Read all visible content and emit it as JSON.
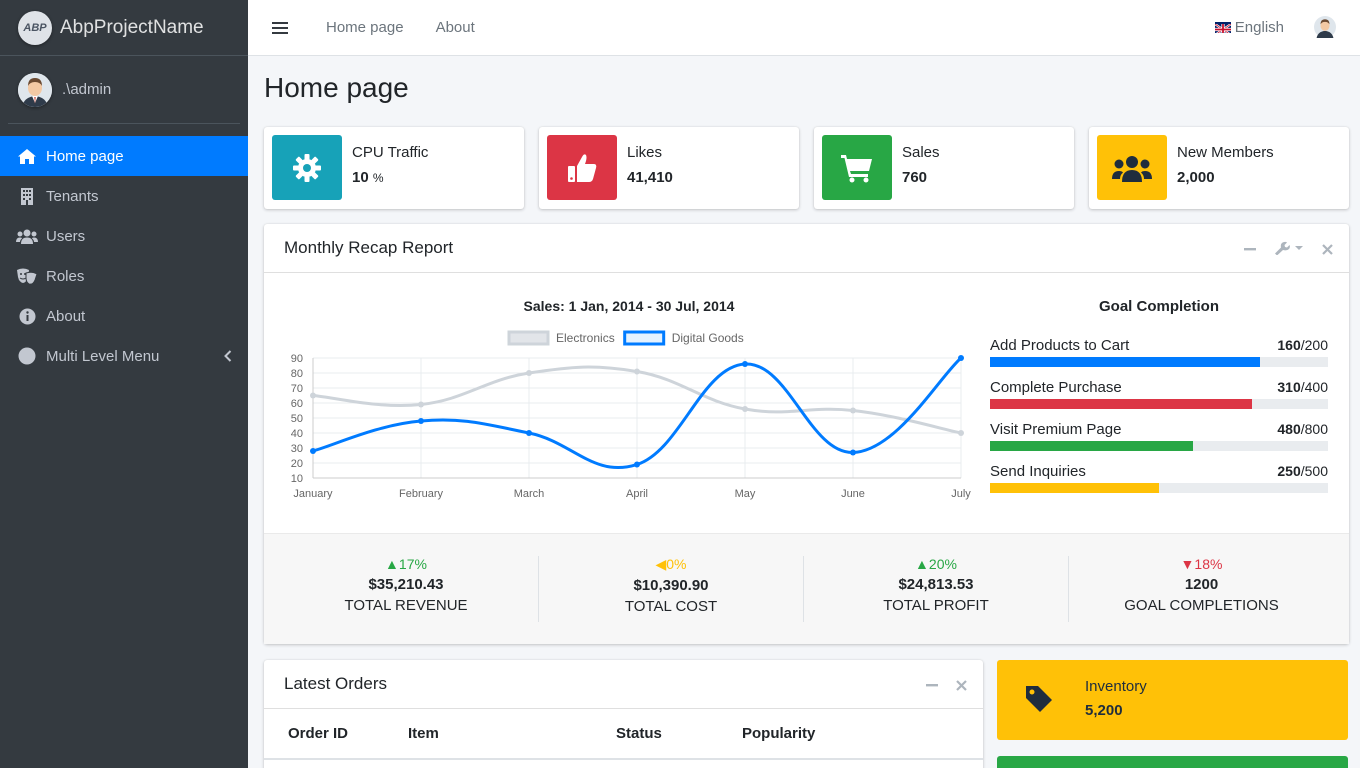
{
  "app": {
    "name": "AbpProjectName",
    "logo_text": "ABP"
  },
  "user": {
    "name": ".\\admin"
  },
  "sidebar": {
    "items": [
      {
        "label": "Home page",
        "icon": "home-icon",
        "active": true
      },
      {
        "label": "Tenants",
        "icon": "building-icon"
      },
      {
        "label": "Users",
        "icon": "users-icon"
      },
      {
        "label": "Roles",
        "icon": "theater-masks-icon"
      },
      {
        "label": "About",
        "icon": "info-circle-icon"
      },
      {
        "label": "Multi Level Menu",
        "icon": "circle-icon"
      }
    ]
  },
  "topbar": {
    "links": [
      "Home page",
      "About"
    ],
    "language": "English"
  },
  "page": {
    "title": "Home page"
  },
  "info_boxes": [
    {
      "label": "CPU Traffic",
      "value": "10",
      "unit": "%",
      "color": "#17a2b8",
      "icon": "gear-icon"
    },
    {
      "label": "Likes",
      "value": "41,410",
      "color": "#dc3545",
      "icon": "thumbs-up-icon"
    },
    {
      "label": "Sales",
      "value": "760",
      "color": "#28a745",
      "icon": "shopping-cart-icon"
    },
    {
      "label": "New Members",
      "value": "2,000",
      "color": "#ffc107",
      "icon": "users-icon"
    }
  ],
  "recap": {
    "title": "Monthly Recap Report",
    "goal_title": "Goal Completion",
    "goals": [
      {
        "label": "Add Products to Cart",
        "value": "160",
        "total": "/200",
        "fraction": 0.8,
        "color": "#007bff"
      },
      {
        "label": "Complete Purchase",
        "value": "310",
        "total": "/400",
        "fraction": 0.775,
        "color": "#dc3545"
      },
      {
        "label": "Visit Premium Page",
        "value": "480",
        "total": "/800",
        "fraction": 0.6,
        "color": "#28a745"
      },
      {
        "label": "Send Inquiries",
        "value": "250",
        "total": "/500",
        "fraction": 0.5,
        "color": "#ffc107"
      }
    ],
    "stats": [
      {
        "pct": "17%",
        "direction": "up",
        "color": "#28a745",
        "amount": "$35,210.43",
        "label": "TOTAL REVENUE"
      },
      {
        "pct": "0%",
        "direction": "left",
        "color": "#ffc107",
        "amount": "$10,390.90",
        "label": "TOTAL COST"
      },
      {
        "pct": "20%",
        "direction": "up",
        "color": "#28a745",
        "amount": "$24,813.53",
        "label": "TOTAL PROFIT"
      },
      {
        "pct": "18%",
        "direction": "down",
        "color": "#dc3545",
        "amount": "1200",
        "label": "GOAL COMPLETIONS"
      }
    ]
  },
  "chart_data": {
    "type": "line",
    "title": "Sales: 1 Jan, 2014 - 30 Jul, 2014",
    "categories": [
      "January",
      "February",
      "March",
      "April",
      "May",
      "June",
      "July"
    ],
    "series": [
      {
        "name": "Electronics",
        "values": [
          65,
          59,
          80,
          81,
          56,
          55,
          40
        ],
        "color": "#ced4da"
      },
      {
        "name": "Digital Goods",
        "values": [
          28,
          48,
          40,
          19,
          86,
          27,
          90
        ],
        "color": "#007bff"
      }
    ],
    "ylim": [
      10,
      90
    ],
    "yticks": [
      10,
      20,
      30,
      40,
      50,
      60,
      70,
      80,
      90
    ],
    "legend": "top",
    "grid": true
  },
  "orders": {
    "title": "Latest Orders",
    "columns": [
      "Order ID",
      "Item",
      "Status",
      "Popularity"
    ]
  },
  "inventory": {
    "label": "Inventory",
    "value": "5,200",
    "icon": "tag-icon"
  }
}
